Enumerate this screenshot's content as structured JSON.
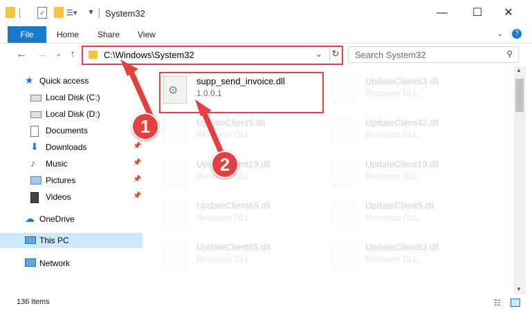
{
  "window": {
    "title": "System32",
    "minimize": "—",
    "maximize": "☐",
    "close": "✕"
  },
  "ribbon": {
    "tabs": [
      "File",
      "Home",
      "Share",
      "View"
    ],
    "expand_icon": "chevron-down-icon",
    "help_icon": "?"
  },
  "address": {
    "path": "C:\\Windows\\System32",
    "dropdown": "⌄",
    "refresh": "↻"
  },
  "search": {
    "placeholder": "Search System32"
  },
  "sidebar": {
    "items": [
      {
        "label": "Quick access",
        "icon": "star-icon",
        "pinned": false
      },
      {
        "label": "Local Disk (C:)",
        "icon": "drive-icon",
        "pinned": false
      },
      {
        "label": "Local Disk (D:)",
        "icon": "drive-icon",
        "pinned": false
      },
      {
        "label": "Documents",
        "icon": "documents-icon",
        "pinned": true
      },
      {
        "label": "Downloads",
        "icon": "download-icon",
        "pinned": true
      },
      {
        "label": "Music",
        "icon": "music-icon",
        "pinned": true
      },
      {
        "label": "Pictures",
        "icon": "pictures-icon",
        "pinned": true
      },
      {
        "label": "Videos",
        "icon": "videos-icon",
        "pinned": true
      },
      {
        "label": "OneDrive",
        "icon": "cloud-icon",
        "pinned": false
      },
      {
        "label": "This PC",
        "icon": "pc-icon",
        "pinned": false,
        "selected": true
      },
      {
        "label": "Network",
        "icon": "network-icon",
        "pinned": false
      }
    ]
  },
  "files": [
    {
      "name": "supp_send_invoice.dll",
      "sub": "1.0.0.1",
      "highlighted": true
    },
    {
      "name": "UpdateClient63.dll",
      "sub": "Resource DLL"
    },
    {
      "name": "UpdateClient5.dll",
      "sub": "Resource DLL"
    },
    {
      "name": "UpdateClient42.dll",
      "sub": "Resource DLL"
    },
    {
      "name": "UpdateClient19.dll",
      "sub": "Resource DLL"
    },
    {
      "name": "UpdateClient19.dll",
      "sub": "Resource DLL"
    },
    {
      "name": "UpdateClient65.dll",
      "sub": "Resource DLL"
    },
    {
      "name": "UpdateClient5.dll",
      "sub": "Resource DLL"
    },
    {
      "name": "UpdateClient65.dll",
      "sub": "Resource DLL"
    },
    {
      "name": "UpdateClient63.dll",
      "sub": "Resource DLL"
    }
  ],
  "status": {
    "count": "136 items"
  },
  "callouts": [
    "1",
    "2"
  ],
  "colors": {
    "accent": "#1979ca",
    "callout": "#e53f3f",
    "selection": "#cce8ff"
  }
}
